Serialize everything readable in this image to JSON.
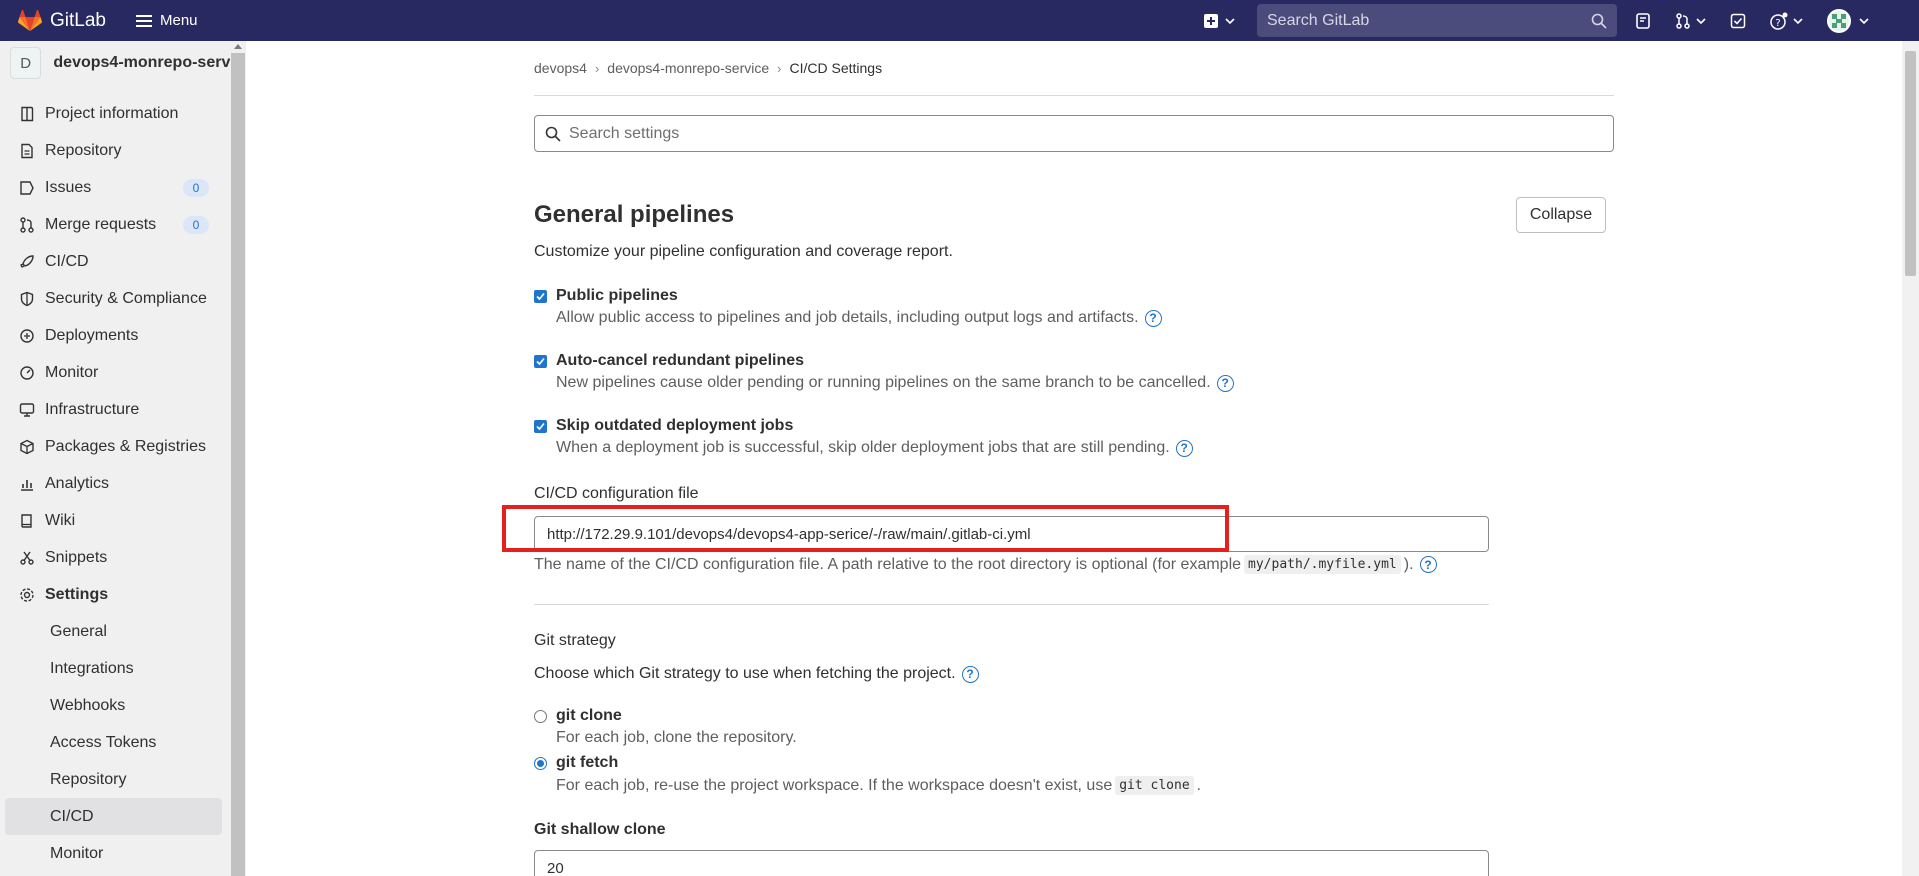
{
  "topbar": {
    "brand": "GitLab",
    "menu_label": "Menu",
    "search_placeholder": "Search GitLab",
    "colors": {
      "navbar": "#292961",
      "search_bg": "#4c4c7c",
      "logo": "#e24329"
    }
  },
  "sidebar": {
    "project_initial": "D",
    "project_name": "devops4-monrepo-serv.",
    "items": [
      {
        "label": "Project information",
        "icon": "information-icon"
      },
      {
        "label": "Repository",
        "icon": "document-icon"
      },
      {
        "label": "Issues",
        "icon": "issues-icon",
        "badge": "0"
      },
      {
        "label": "Merge requests",
        "icon": "git-merge-icon",
        "badge": "0"
      },
      {
        "label": "CI/CD",
        "icon": "rocket-icon"
      },
      {
        "label": "Security & Compliance",
        "icon": "shield-icon"
      },
      {
        "label": "Deployments",
        "icon": "deployments-icon"
      },
      {
        "label": "Monitor",
        "icon": "monitor-icon"
      },
      {
        "label": "Infrastructure",
        "icon": "cloud-icon"
      },
      {
        "label": "Packages & Registries",
        "icon": "package-icon"
      },
      {
        "label": "Analytics",
        "icon": "chart-icon"
      },
      {
        "label": "Wiki",
        "icon": "book-icon"
      },
      {
        "label": "Snippets",
        "icon": "snippet-icon"
      },
      {
        "label": "Settings",
        "icon": "settings-icon"
      }
    ],
    "settings_sub": [
      {
        "label": "General"
      },
      {
        "label": "Integrations"
      },
      {
        "label": "Webhooks"
      },
      {
        "label": "Access Tokens"
      },
      {
        "label": "Repository"
      },
      {
        "label": "CI/CD",
        "active": true
      },
      {
        "label": "Monitor"
      }
    ]
  },
  "breadcrumb": {
    "items": [
      "devops4",
      "devops4-monrepo-service",
      "CI/CD Settings"
    ]
  },
  "search_settings": {
    "placeholder": "Search settings"
  },
  "section": {
    "title": "General pipelines",
    "collapse_label": "Collapse",
    "description": "Customize your pipeline configuration and coverage report."
  },
  "options": {
    "public_pipelines": {
      "label": "Public pipelines",
      "help": "Allow public access to pipelines and job details, including output logs and artifacts.",
      "checked": true
    },
    "auto_cancel": {
      "label": "Auto-cancel redundant pipelines",
      "help": "New pipelines cause older pending or running pipelines on the same branch to be cancelled.",
      "checked": true
    },
    "skip_outdated": {
      "label": "Skip outdated deployment jobs",
      "help": "When a deployment job is successful, skip older deployment jobs that are still pending.",
      "checked": true
    }
  },
  "config_file": {
    "label": "CI/CD configuration file",
    "value": "http://172.29.9.101/devops4/devops4-app-serice/-/raw/main/.gitlab-ci.yml",
    "help_prefix": "The name of the CI/CD configuration file. A path relative to the root directory is optional (for example",
    "help_code": "my/path/.myfile.yml",
    "help_suffix": ")."
  },
  "git_strategy": {
    "label": "Git strategy",
    "description": "Choose which Git strategy to use when fetching the project.",
    "clone": {
      "label": "git clone",
      "help": "For each job, clone the repository.",
      "selected": false
    },
    "fetch": {
      "label": "git fetch",
      "help_prefix": "For each job, re-use the project workspace. If the workspace doesn't exist, use",
      "help_code": "git clone",
      "help_suffix": ".",
      "selected": true
    }
  },
  "shallow_clone": {
    "label": "Git shallow clone",
    "value": "20"
  }
}
